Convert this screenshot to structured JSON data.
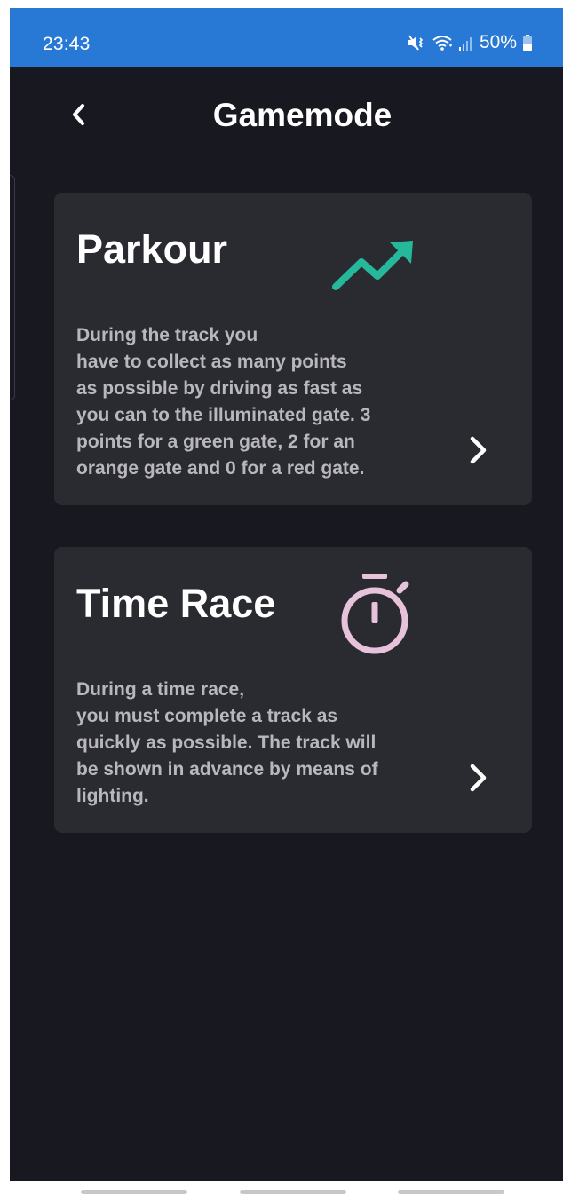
{
  "status_bar": {
    "time": "23:43",
    "battery_percent": "50%",
    "icons": [
      "mute-vibrate-icon",
      "wifi-icon",
      "signal-icon",
      "battery-icon"
    ]
  },
  "header": {
    "title": "Gamemode",
    "back_icon": "chevron-left-icon"
  },
  "modes": [
    {
      "title": "Parkour",
      "description": "During the track you\nhave to collect as many points\nas possible by driving as fast as\nyou can to the illuminated gate. 3\npoints for a green gate, 2 for an\norange gate and 0 for a red gate.",
      "icon": "trending-up-icon",
      "icon_color": "#26b89a"
    },
    {
      "title": "Time Race",
      "description": "During a time race,\nyou must complete a track as\nquickly as possible. The track will\nbe shown in advance by means of\nlighting.",
      "icon": "stopwatch-icon",
      "icon_color": "#e6c3db"
    }
  ],
  "colors": {
    "status_bar": "#2878d6",
    "background": "#181820",
    "card": "#2a2a31",
    "description_text": "#b8b8bc"
  }
}
